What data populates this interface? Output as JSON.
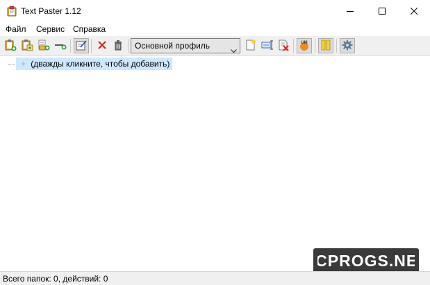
{
  "window": {
    "title": "Text Paster 1.12",
    "app_icon": "clipboard-icon",
    "controls": [
      "minimize-icon",
      "maximize-icon",
      "close-icon"
    ]
  },
  "menu": {
    "items": [
      "Файл",
      "Сервис",
      "Справка"
    ]
  },
  "toolbar": {
    "buttons_left": [
      "add-text-icon",
      "paste-clipboard-icon",
      "add-folder-icon",
      "add-separator-icon",
      "edit-icon",
      "delete-icon",
      "trash-icon"
    ],
    "profile": {
      "selected": "Основной профиль"
    },
    "buttons_right": [
      "new-profile-icon",
      "rename-profile-icon",
      "delete-profile-icon",
      "um-icon",
      "columns-icon",
      "settings-gear-icon"
    ]
  },
  "tree": {
    "node_label": "(дважды кликните, чтобы добавить)"
  },
  "status": {
    "text": "Всего папок: 0, действий: 0"
  },
  "watermark": {
    "text": "PCPROGS.NET"
  },
  "colors": {
    "selection": "#cce8ff",
    "toolbar_bg": "#f0f0f0",
    "watermark_bg": "#3a3a3a"
  }
}
